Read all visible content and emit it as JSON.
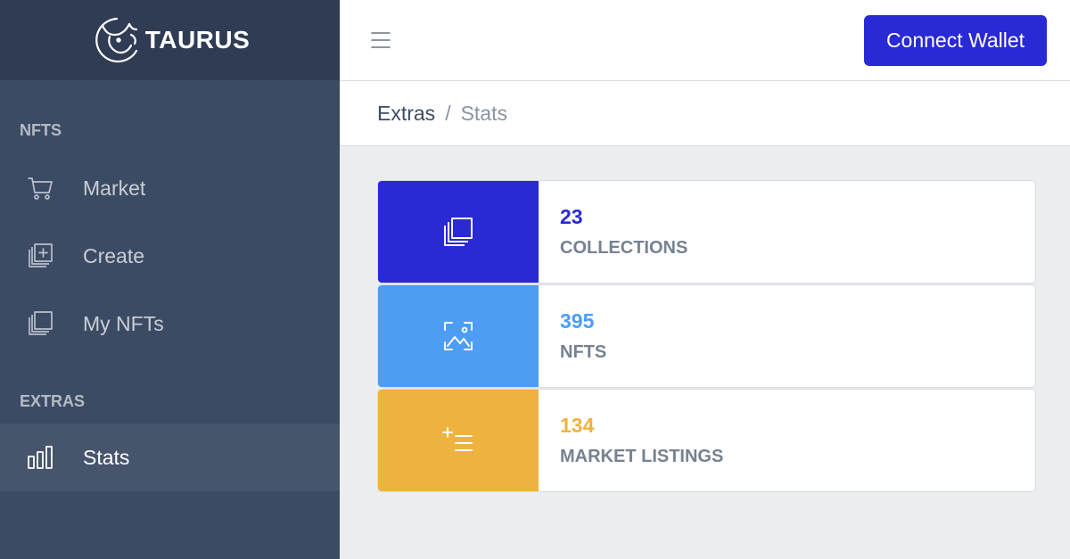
{
  "brand": {
    "name": "TAURUS",
    "logo_icon": "bull-icon"
  },
  "sidebar": {
    "sections": [
      {
        "title": "NFTS"
      },
      {
        "title": "EXTRAS"
      }
    ],
    "items": [
      {
        "label": "Market",
        "icon": "cart-icon"
      },
      {
        "label": "Create",
        "icon": "add-collection-icon"
      },
      {
        "label": "My NFTs",
        "icon": "collection-icon"
      },
      {
        "label": "Stats",
        "icon": "bar-chart-icon",
        "active": true
      }
    ]
  },
  "header": {
    "menu_icon": "hamburger-icon",
    "connect_label": "Connect Wallet",
    "accent": "#2929d6"
  },
  "breadcrumb": {
    "parent": "Extras",
    "separator": "/",
    "current": "Stats"
  },
  "stats": [
    {
      "value": "23",
      "label": "COLLECTIONS",
      "color": "#2929d6",
      "icon": "collection-icon"
    },
    {
      "value": "395",
      "label": "NFTS",
      "color": "#4e9df5",
      "icon": "image-icon"
    },
    {
      "value": "134",
      "label": "MARKET LISTINGS",
      "color": "#eeb33f",
      "icon": "list-add-icon"
    }
  ]
}
